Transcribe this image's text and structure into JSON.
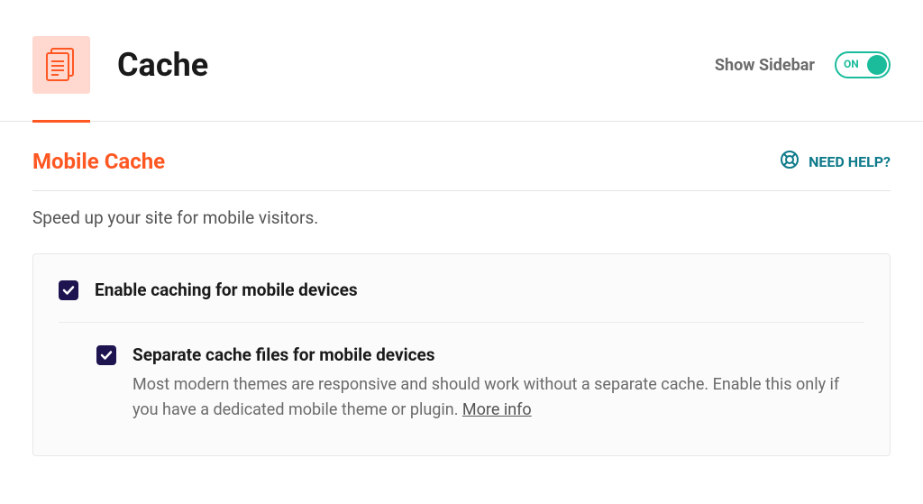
{
  "header": {
    "title": "Cache",
    "sidebar_label": "Show Sidebar",
    "toggle_label": "ON"
  },
  "section": {
    "title": "Mobile Cache",
    "help_label": "NEED HELP?",
    "description": "Speed up your site for mobile visitors."
  },
  "options": {
    "enable_mobile": {
      "label": "Enable caching for mobile devices"
    },
    "separate_files": {
      "label": "Separate cache files for mobile devices",
      "description": "Most modern themes are responsive and should work without a separate cache. Enable this only if you have a dedicated mobile theme or plugin. ",
      "more_info": "More info"
    }
  }
}
